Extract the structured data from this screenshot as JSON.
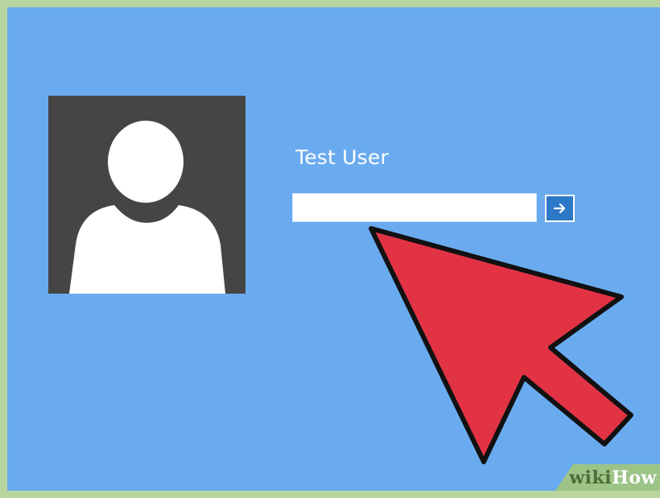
{
  "login": {
    "user_name": "Test User",
    "password_value": "",
    "submit_glyph": "→",
    "avatar_icon": "user-silhouette-icon",
    "submit_icon": "arrow-right-icon"
  },
  "overlay": {
    "pointer_icon": "red-arrow-pointer-icon",
    "pointer_color": "#e23345"
  },
  "watermark": {
    "wiki": "wiki",
    "how": "How"
  },
  "colors": {
    "frame": "#b9d6a0",
    "screen_background": "#6aabef",
    "avatar_tile": "#454545",
    "submit_button": "#2e78c8",
    "watermark_band": "#9cc487"
  }
}
